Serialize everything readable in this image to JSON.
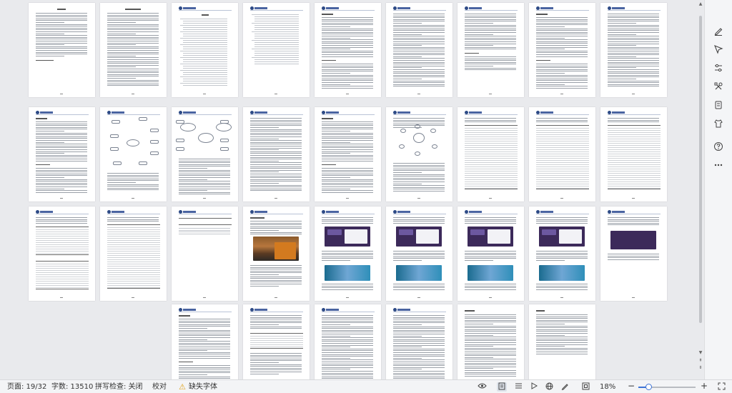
{
  "status_bar": {
    "page_label": "页面: 19/32",
    "word_count_label": "字数: 13510",
    "spell_check_label": "拼写检查: 关闭",
    "proofread_label": "校对",
    "missing_font_label": "缺失字体",
    "zoom_label": "18%",
    "zoom_level": 0.18,
    "zoom_minus": "−",
    "zoom_plus": "+"
  },
  "icons": {
    "right_toolbar": [
      "pen-icon",
      "cursor-icon",
      "sliders-icon",
      "tools-icon",
      "document-icon",
      "shirt-icon",
      "help-icon",
      "more-icon"
    ],
    "status_bar": [
      "warning-icon",
      "eye-icon",
      "page-view-icon",
      "list-view-icon",
      "play-icon",
      "globe-icon",
      "pencil-icon",
      "fit-icon",
      "fullscreen-icon"
    ]
  },
  "colors": {
    "accent": "#3d73d6",
    "header_blue": "#2d4a86",
    "warning": "#e0a21c",
    "slide_purple": "#3c2a5a"
  }
}
